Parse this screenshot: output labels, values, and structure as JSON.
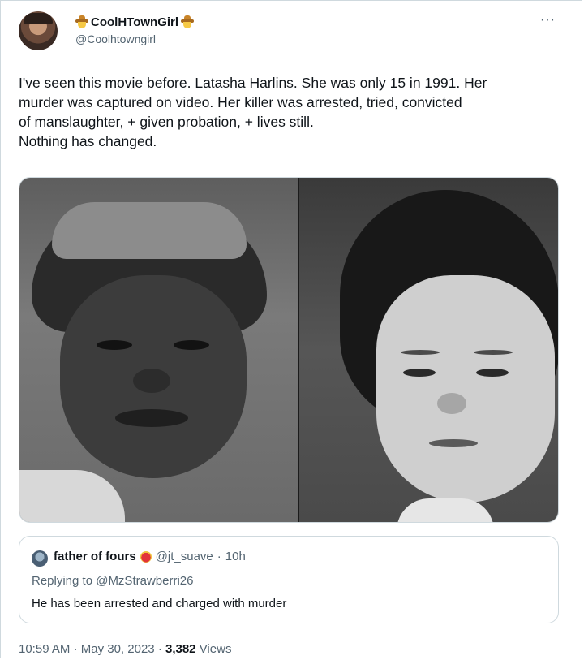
{
  "author": {
    "display_name": "CoolHTownGirl",
    "handle": "@Coolhtowngirl",
    "emoji_icon": "cowboy-hat-face-icon"
  },
  "more_menu": "···",
  "tweet": {
    "text": "I've seen this movie before. Latasha Harlins. She was only 15 in 1991. Her\nmurder was captured on video.  Her killer was arrested, tried, convicted\nof manslaughter, + given probation, + lives still.\nNothing has changed."
  },
  "media": {
    "images": [
      "black-and-white portrait of a girl",
      "black-and-white portrait of a woman"
    ]
  },
  "quoted_tweet": {
    "name": "father of fours",
    "badge_icon": "heart-emoji-icon",
    "handle": "@jt_suave",
    "separator": "·",
    "time": "10h",
    "replying_to": "Replying to @MzStrawberri26",
    "text": "He has been arrested and charged with murder"
  },
  "footer": {
    "time": "10:59 AM",
    "sep1": "·",
    "date": "May 30, 2023",
    "sep2": "·",
    "views_count": "3,382",
    "views_label": "Views"
  },
  "colors": {
    "text": "#0f1419",
    "secondary": "#536471",
    "border": "#cfd9de"
  }
}
